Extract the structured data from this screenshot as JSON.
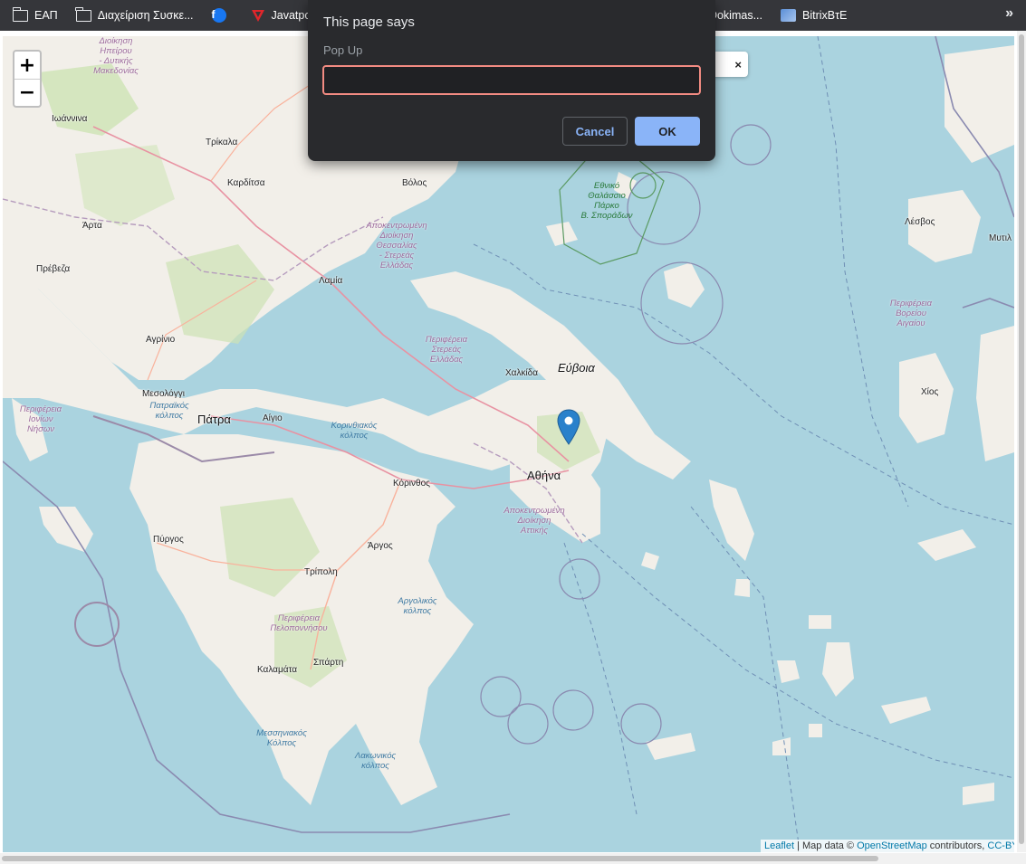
{
  "bookmarks": {
    "items": [
      {
        "label": "ΕΑΠ",
        "icon": "folder-icon"
      },
      {
        "label": "Διαχείριση Συσκε...",
        "icon": "folder-icon"
      },
      {
        "label": "",
        "icon": "facebook-icon"
      },
      {
        "label": "Javatpoint",
        "icon": "javatpoint-icon"
      },
      {
        "label": "ος Dokimas...",
        "icon": "site-icon"
      },
      {
        "label": "BitrixΒτΕ",
        "icon": "bitrix-icon"
      }
    ],
    "more": "»"
  },
  "map": {
    "zoom_in": "+",
    "zoom_out": "−",
    "popup_close": "×",
    "places": {
      "ioannina": "Ιωάννινα",
      "trikala": "Τρίκαλα",
      "karditsa": "Καρδίτσα",
      "volos": "Βόλος",
      "arta": "Άρτα",
      "preveza": "Πρέβεζα",
      "lamia": "Λαμία",
      "agrinio": "Αγρίνιο",
      "mesolongi": "Μεσολόγγι",
      "patra": "Πάτρα",
      "aigio": "Αίγιο",
      "chalkida": "Χαλκίδα",
      "evia": "Εύβοια",
      "athina": "Αθήνα",
      "korinthos": "Κόρινθος",
      "pyrgos": "Πύργος",
      "argos": "Άργος",
      "tripoli": "Τρίπολη",
      "kalamata": "Καλαμάτα",
      "sparti": "Σπάρτη",
      "lesvos": "Λέσβος",
      "mytilini": "Μυτιλ",
      "chios": "Χίος"
    },
    "regions": {
      "epirus": "Διοίκηση\nΗπείρου\n- Δυτικής\nΜακεδονίας",
      "thessaly": "Αποκεντρωμένη\nΔιοίκηση\nΘεσσαλίας\n- Στερεάς\nΕλλάδας",
      "sterea": "Περιφέρεια\nΣτερεάς\nΕλλάδας",
      "ionian": "Περιφέρεια\nΙονίων\nΝήσων",
      "attica": "Αποκεντρωμένη\nΔιοίκηση\nΑττικής",
      "peloponnese": "Περιφέρεια\nΠελοποννήσου",
      "north_aegean": "Περιφέρεια\nΒορείου\nΑιγαίου"
    },
    "seas": {
      "patraikos": "Πατραϊκός\nκόλπος",
      "korinthiakos": "Κορινθιακός\nκόλπος",
      "argolikos": "Αργολικός\nκόλπος",
      "messiniakos": "Μεσσηνιακός\nΚόλπος",
      "lakonikos": "Λακωνικός\nκόλπος"
    },
    "park": "Εθνικό\nΘαλάσσιο\nΠάρκο\nΒ. Σποράδων",
    "attribution": {
      "leaflet": "Leaflet",
      "sep": " | Map data © ",
      "osm": "OpenStreetMap",
      "contrib": " contributors, ",
      "license": "CC-BY-SA"
    }
  },
  "dialog": {
    "title": "This page says",
    "message": "Pop Up",
    "input_value": "",
    "cancel_label": "Cancel",
    "ok_label": "OK"
  },
  "colors": {
    "sea": "#aad3df",
    "land": "#f2efe9",
    "dialog_bg": "#292a2d",
    "accent": "#8ab4f8",
    "input_border": "#f28b82",
    "marker": "#2a81cb"
  }
}
